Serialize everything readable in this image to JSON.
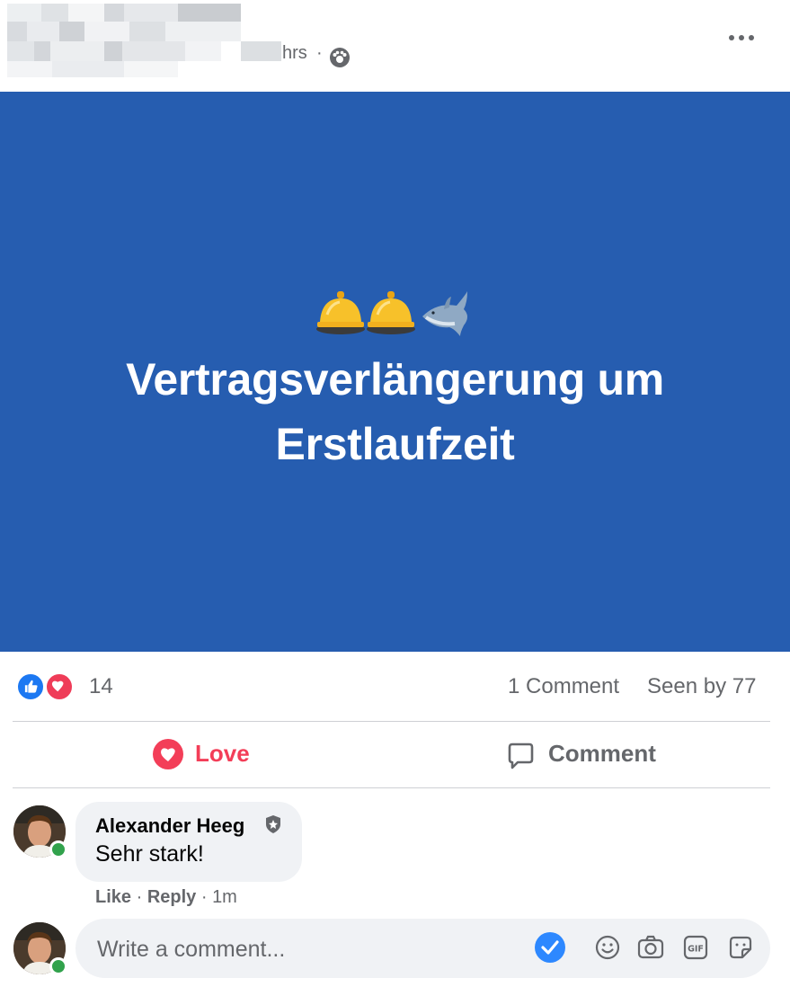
{
  "header": {
    "time": "hrs",
    "separator": "·",
    "audience_icon": "friends-icon",
    "more_icon": "more-horizontal-icon"
  },
  "post": {
    "background_color": "#265db0",
    "emojis": [
      "bellhop-bell",
      "bellhop-bell",
      "shark"
    ],
    "text_line1": "Vertragsverlängerung um",
    "text_line2": "Erstlaufzeit"
  },
  "reactions": {
    "types": [
      "like",
      "love"
    ],
    "count": "14",
    "comments": "1 Comment",
    "seen_by": "Seen by 77"
  },
  "actions": {
    "love_label": "Love",
    "comment_label": "Comment"
  },
  "comment": {
    "author": "Alexander Heeg",
    "text": "Sehr stark!",
    "like": "Like",
    "dot": " · ",
    "reply": "Reply",
    "time": "1m"
  },
  "composer": {
    "placeholder": "Write a comment...",
    "tools": [
      "checkmark-icon",
      "emoji-icon",
      "camera-icon",
      "gif-icon",
      "sticker-icon"
    ]
  },
  "colors": {
    "accent_love": "#f33e58",
    "like_blue": "#1c78f2",
    "online": "#31a24c"
  }
}
